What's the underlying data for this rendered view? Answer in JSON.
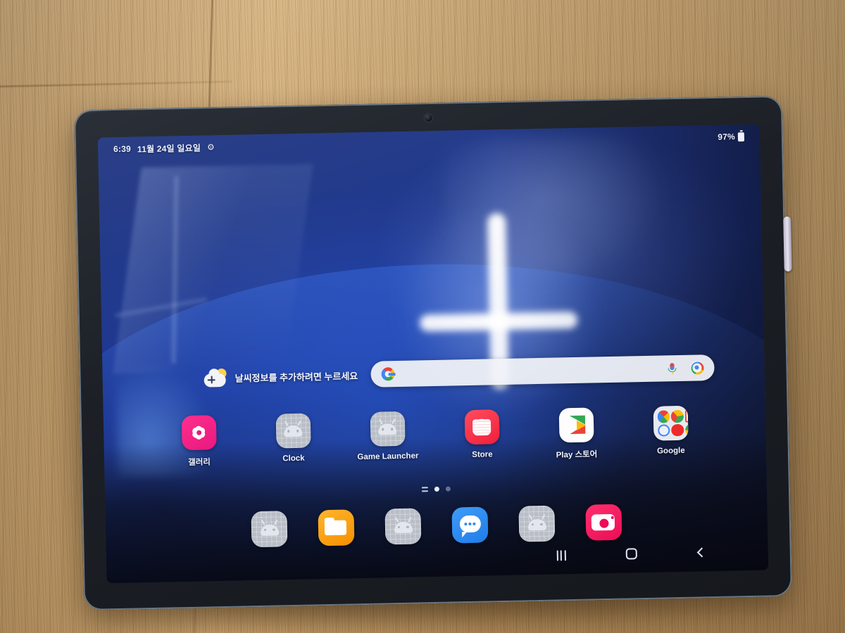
{
  "scene": {
    "device": "tablet",
    "surface": "wood-desk"
  },
  "status_bar": {
    "time": "6:39",
    "date": "11월 24일 일요일",
    "settings_icon": "gear-icon",
    "battery_percent": "97%",
    "battery_icon": "battery-full-icon"
  },
  "widget": {
    "weather_prompt": "날씨정보를 추가하려면 누르세요",
    "icon": "weather-add-icon"
  },
  "search": {
    "placeholder": "",
    "value": "",
    "google_icon": "google-g-icon",
    "mic_icon": "microphone-icon",
    "lens_icon": "google-lens-icon"
  },
  "apps": [
    {
      "label": "갤러리",
      "icon": "gallery-icon"
    },
    {
      "label": "Clock",
      "icon": "placeholder-android-icon"
    },
    {
      "label": "Game Launcher",
      "icon": "placeholder-android-icon"
    },
    {
      "label": "Store",
      "icon": "galaxy-store-icon"
    },
    {
      "label": "Play 스토어",
      "icon": "play-store-icon"
    },
    {
      "label": "Google",
      "icon": "google-folder-icon"
    }
  ],
  "google_folder_apps": [
    {
      "name": "Google",
      "color": "#f5f5f7"
    },
    {
      "name": "Chrome",
      "color": "#f0f2f5"
    },
    {
      "name": "Gmail",
      "color": "#f7f8fa"
    },
    {
      "name": "Maps",
      "color": "#eef1f6"
    },
    {
      "name": "YouTube",
      "color": "#ee2b2b"
    },
    {
      "name": "Photos",
      "color": "#eef1f6"
    }
  ],
  "page_indicator": {
    "app_list_glyph": "hamburger-icon",
    "pages": 2,
    "active_page": 1
  },
  "dock": [
    {
      "name": "placeholder-1",
      "icon": "placeholder-android-icon"
    },
    {
      "name": "My Files",
      "icon": "my-files-icon"
    },
    {
      "name": "placeholder-2",
      "icon": "placeholder-android-icon"
    },
    {
      "name": "Messages",
      "icon": "messages-icon"
    },
    {
      "name": "placeholder-3",
      "icon": "placeholder-android-icon"
    },
    {
      "name": "Camera",
      "icon": "camera-icon"
    }
  ],
  "nav_bar": {
    "recents": "recents-icon",
    "home": "home-icon",
    "back": "back-icon"
  },
  "colors": {
    "accent_blue": "#1e3792",
    "gallery_pink": "#e8187e",
    "store_red": "#f01f3b",
    "files_orange": "#f59000",
    "messages_blue": "#1f7de8",
    "camera_pink": "#ec0d56",
    "desk_wood": "#c8a069"
  }
}
